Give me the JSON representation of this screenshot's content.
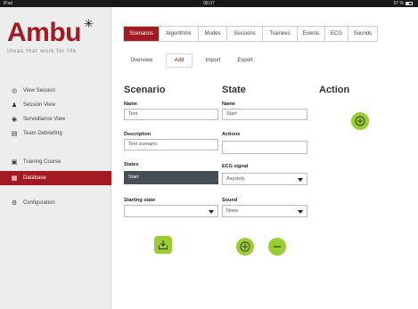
{
  "statusbar": {
    "left": "iPad",
    "time": "08:37",
    "right": "57 %"
  },
  "brand": {
    "logo": "Ambu",
    "tagline": "Ideas that work for life"
  },
  "sidebar": {
    "items": [
      {
        "label": "View Session",
        "icon": "eye-icon"
      },
      {
        "label": "Session View",
        "icon": "person-icon"
      },
      {
        "label": "Surveillance View",
        "icon": "surveillance-icon"
      },
      {
        "label": "Team Debriefing",
        "icon": "document-icon"
      },
      {
        "label": "Training Course",
        "icon": "training-icon"
      },
      {
        "label": "Database",
        "icon": "database-icon"
      },
      {
        "label": "Configuration",
        "icon": "configuration-icon"
      }
    ]
  },
  "tabs": [
    "Scenarios",
    "Algorithms",
    "Modes",
    "Sessions",
    "Trainees",
    "Events",
    "ECG",
    "Sounds"
  ],
  "subtabs": [
    "Overview",
    "Add",
    "Import",
    "Export"
  ],
  "scenario": {
    "heading": "Scenario",
    "name_label": "Name",
    "name_value": "Test",
    "description_label": "Description",
    "description_value": "Test scenario",
    "states_label": "States",
    "states_selected": "Start",
    "starting_label": "Starting state",
    "starting_value": ""
  },
  "state": {
    "heading": "State",
    "name_label": "Name",
    "name_value": "Start",
    "actions_label": "Actions",
    "actions_value": "",
    "ecg_label": "ECG signal",
    "ecg_value": "Asystoly",
    "sound_label": "Sound",
    "sound_value": "None"
  },
  "action": {
    "heading": "Action"
  },
  "colors": {
    "accent": "#a31a22",
    "green": "#9acd32",
    "selected_row": "#464d57",
    "sidebar_bg": "#ededed"
  }
}
